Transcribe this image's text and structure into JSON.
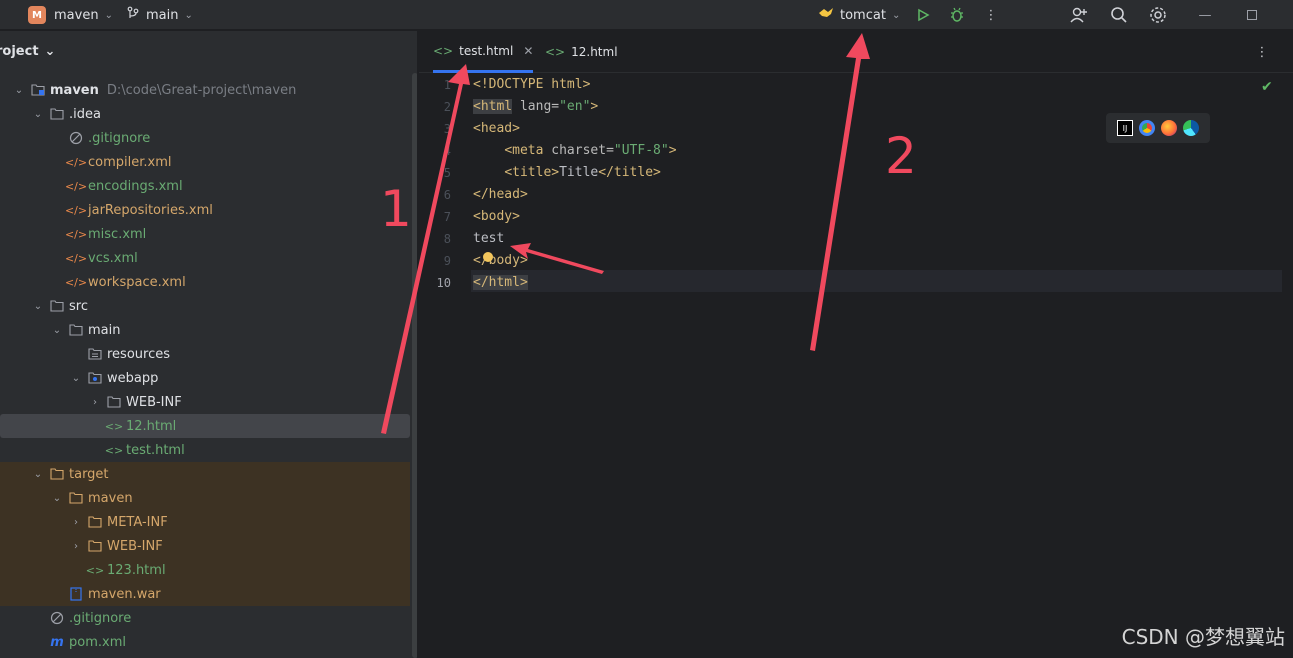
{
  "titlebar": {
    "project_badge": "M",
    "project_name": "maven",
    "branch": "main",
    "run_config": "tomcat",
    "icons": [
      "branch-icon",
      "tomcat-icon",
      "run-icon",
      "debug-icon",
      "more-icon",
      "add-user-icon",
      "search-icon",
      "settings-icon",
      "minimize-icon",
      "maximize-icon"
    ]
  },
  "project_panel": {
    "title": "roject",
    "tree": [
      {
        "label": "maven",
        "extra": "D:\\code\\Great-project\\maven",
        "depth": 0,
        "expanded": true,
        "icon": "module-folder-icon",
        "color": "default",
        "bold": true
      },
      {
        "label": ".idea",
        "depth": 1,
        "expanded": true,
        "icon": "folder-icon",
        "color": "default"
      },
      {
        "label": ".gitignore",
        "depth": 2,
        "icon": "ignore-file-icon",
        "color": "green"
      },
      {
        "label": "compiler.xml",
        "depth": 2,
        "icon": "xml-icon",
        "color": "orange"
      },
      {
        "label": "encodings.xml",
        "depth": 2,
        "icon": "xml-icon",
        "color": "green"
      },
      {
        "label": "jarRepositories.xml",
        "depth": 2,
        "icon": "xml-icon",
        "color": "orange"
      },
      {
        "label": "misc.xml",
        "depth": 2,
        "icon": "xml-icon",
        "color": "green"
      },
      {
        "label": "vcs.xml",
        "depth": 2,
        "icon": "xml-icon",
        "color": "green"
      },
      {
        "label": "workspace.xml",
        "depth": 2,
        "icon": "xml-icon",
        "color": "orange"
      },
      {
        "label": "src",
        "depth": 1,
        "expanded": true,
        "icon": "folder-icon",
        "color": "default"
      },
      {
        "label": "main",
        "depth": 2,
        "expanded": true,
        "icon": "folder-icon",
        "color": "default"
      },
      {
        "label": "resources",
        "depth": 3,
        "icon": "resources-folder-icon",
        "color": "default"
      },
      {
        "label": "webapp",
        "depth": 3,
        "expanded": true,
        "icon": "web-folder-icon",
        "color": "default"
      },
      {
        "label": "WEB-INF",
        "depth": 4,
        "expanded": false,
        "icon": "folder-icon",
        "color": "default"
      },
      {
        "label": "12.html",
        "depth": 4,
        "icon": "html-icon",
        "color": "green",
        "selected": true
      },
      {
        "label": "test.html",
        "depth": 4,
        "icon": "html-icon",
        "color": "green"
      },
      {
        "label": "target",
        "depth": 1,
        "expanded": true,
        "icon": "folder-icon",
        "color": "orange",
        "excluded": true
      },
      {
        "label": "maven",
        "depth": 2,
        "expanded": true,
        "icon": "folder-icon",
        "color": "orange",
        "excluded": true
      },
      {
        "label": "META-INF",
        "depth": 3,
        "expanded": false,
        "icon": "folder-icon",
        "color": "orange",
        "excluded": true
      },
      {
        "label": "WEB-INF",
        "depth": 3,
        "expanded": false,
        "icon": "folder-icon",
        "color": "orange",
        "excluded": true
      },
      {
        "label": "123.html",
        "depth": 3,
        "icon": "html-icon",
        "color": "green",
        "excluded": true
      },
      {
        "label": "maven.war",
        "depth": 2,
        "icon": "archive-icon",
        "color": "orange",
        "excluded": true
      },
      {
        "label": ".gitignore",
        "depth": 1,
        "icon": "ignore-file-icon",
        "color": "green"
      },
      {
        "label": "pom.xml",
        "depth": 1,
        "icon": "maven-icon",
        "color": "green"
      }
    ]
  },
  "editor": {
    "tabs": [
      {
        "label": "test.html",
        "active": true
      },
      {
        "label": "12.html",
        "active": false
      }
    ],
    "line_numbers": [
      "1",
      "2",
      "3",
      "4",
      "5",
      "6",
      "7",
      "8",
      "9",
      "10"
    ],
    "current_line": "10",
    "code": [
      [
        [
          "tag",
          "<!DOCTYPE html>"
        ]
      ],
      [
        [
          "tag hl",
          "<html"
        ],
        [
          "attr",
          " lang="
        ],
        [
          "str",
          "\"en\""
        ],
        [
          "tag",
          ">"
        ]
      ],
      [
        [
          "tag",
          "<head>"
        ]
      ],
      [
        [
          "plain",
          "    "
        ],
        [
          "tag",
          "<meta"
        ],
        [
          "attr",
          " charset="
        ],
        [
          "str",
          "\"UTF-8\""
        ],
        [
          "tag",
          ">"
        ]
      ],
      [
        [
          "plain",
          "    "
        ],
        [
          "tag",
          "<title>"
        ],
        [
          "plain",
          "Title"
        ],
        [
          "tag",
          "</title>"
        ]
      ],
      [
        [
          "tag",
          "</head>"
        ]
      ],
      [
        [
          "tag",
          "<body>"
        ]
      ],
      [
        [
          "plain",
          "test"
        ]
      ],
      [
        [
          "tag",
          "</body>"
        ]
      ],
      [
        [
          "tag hl",
          "</html>"
        ]
      ]
    ]
  },
  "annotations": {
    "label_1": "1",
    "label_2": "2",
    "color": "#f0495e"
  },
  "watermark": "CSDN @梦想翼站"
}
